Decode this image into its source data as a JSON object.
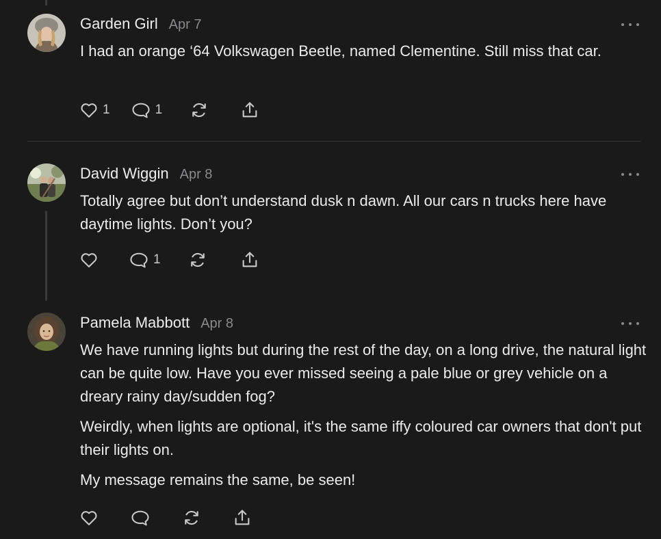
{
  "comments": [
    {
      "author": "Garden Girl",
      "date": "Apr 7",
      "paragraphs": [
        "I had an orange ‘64 Volkswagen Beetle, named Clementine. Still miss that car."
      ],
      "likes": "1",
      "replies": "1"
    },
    {
      "author": "David Wiggin",
      "date": "Apr 8",
      "paragraphs": [
        "Totally agree but don’t understand dusk n dawn. All our cars n trucks here have daytime lights. Don’t you?"
      ],
      "likes": "",
      "replies": "1"
    },
    {
      "author": "Pamela Mabbott",
      "date": "Apr 8",
      "paragraphs": [
        "We have running lights but during the rest of the day, on a long drive, the natural light can be quite low. Have you ever missed seeing a pale blue or grey vehicle on a dreary rainy day/sudden fog?",
        "Weirdly, when lights are optional, it's the same iffy coloured car owners that don't put their lights on.",
        "My message remains the same, be seen!"
      ],
      "likes": "",
      "replies": ""
    }
  ],
  "icons": {
    "like": "heart-icon",
    "reply": "comment-bubble-icon",
    "restack": "restack-icon",
    "share": "share-icon",
    "more": "more-options-icon"
  },
  "colors": {
    "background": "#1a1a1b",
    "text": "#ebebeb",
    "muted": "#8a8a8d",
    "divider": "#333335"
  }
}
